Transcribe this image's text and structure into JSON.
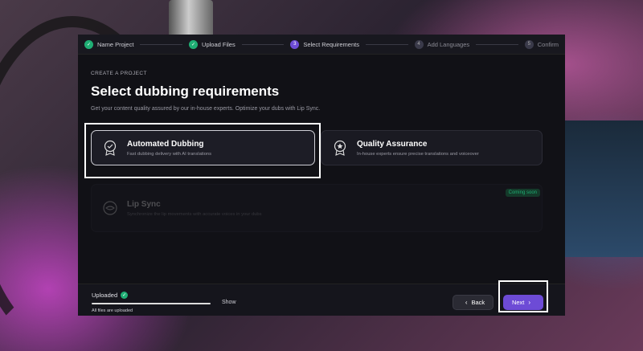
{
  "stepper": {
    "steps": [
      {
        "num": "✓",
        "label": "Name Project",
        "state": "done"
      },
      {
        "num": "✓",
        "label": "Upload Files",
        "state": "done"
      },
      {
        "num": "3",
        "label": "Select Requirements",
        "state": "active"
      },
      {
        "num": "4",
        "label": "Add Languages",
        "state": "todo"
      },
      {
        "num": "5",
        "label": "Confirm",
        "state": "todo"
      }
    ]
  },
  "header": {
    "eyebrow": "CREATE A PROJECT",
    "title": "Select dubbing requirements",
    "subtitle": "Get your content quality assured by our in-house experts. Optimize your dubs with Lip Sync."
  },
  "options": {
    "automated": {
      "title": "Automated Dubbing",
      "desc": "Fast dubbing delivery with AI translations",
      "icon": "badge-check-icon",
      "selected": true
    },
    "quality": {
      "title": "Quality Assurance",
      "desc": "In-house experts ensure precise translations and voiceover",
      "icon": "award-icon"
    },
    "lipsync": {
      "title": "Lip Sync",
      "desc": "Synchronize the lip movements with accurate voices in your dubs",
      "icon": "lips-icon",
      "badge": "Coming soon"
    }
  },
  "footer": {
    "uploaded_label": "Uploaded",
    "upload_progress": 1.0,
    "show_label": "Show",
    "note": "All files are uploaded",
    "back_label": "Back",
    "next_label": "Next"
  },
  "colors": {
    "accent": "#6d4bd6",
    "success": "#1fae74"
  }
}
